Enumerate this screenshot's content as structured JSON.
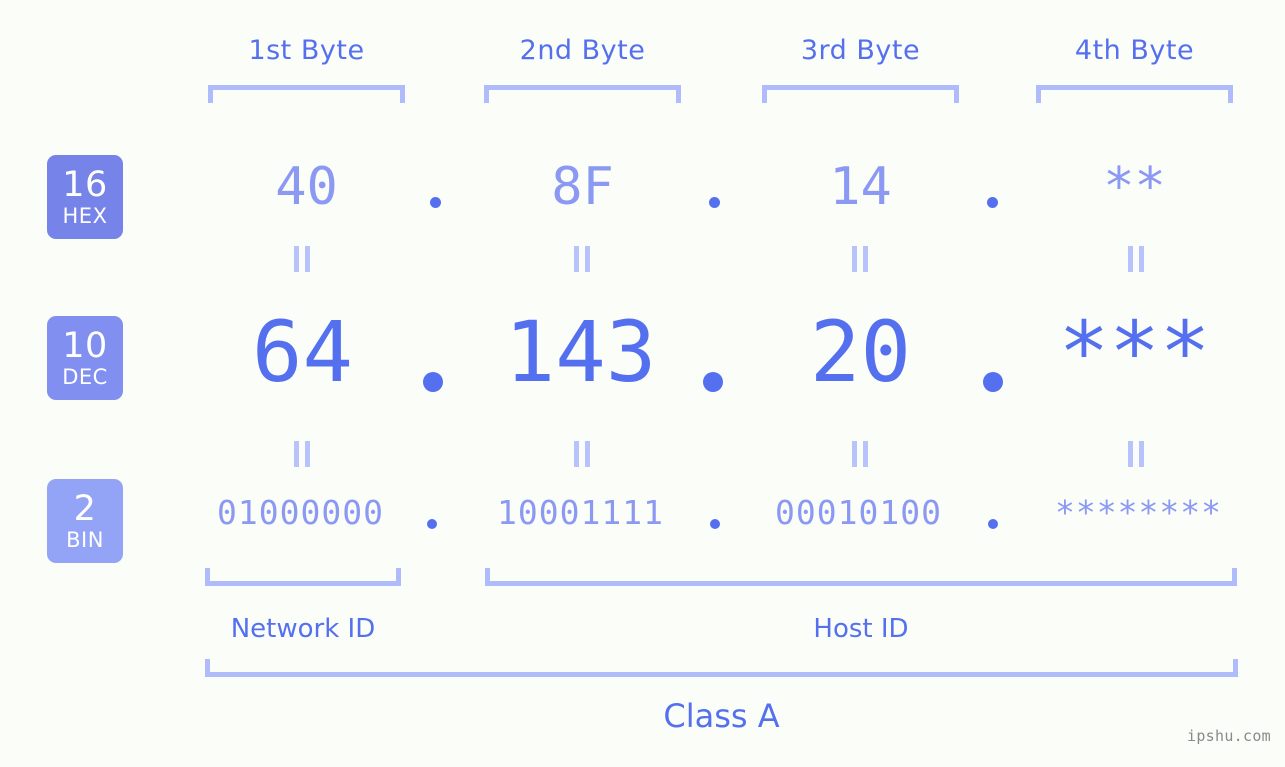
{
  "theme": {
    "background": "#fbfdf9",
    "accent_strong": "#5570ee",
    "accent_light": "#8b99f3",
    "bracket": "#b0bbfb",
    "equals": "#b9c3fb",
    "badge_hex_bg": "#7683e8",
    "badge_dec_bg": "#8190f0",
    "badge_bin_bg": "#93a3f5",
    "watermark_color": "#8a8a8a"
  },
  "byte_headers": [
    {
      "label": "1st Byte"
    },
    {
      "label": "2nd Byte"
    },
    {
      "label": "3rd Byte"
    },
    {
      "label": "4th Byte"
    }
  ],
  "radix_badges": [
    {
      "base": "16",
      "name": "HEX"
    },
    {
      "base": "10",
      "name": "DEC"
    },
    {
      "base": "2",
      "name": "BIN"
    }
  ],
  "rows": {
    "hex": {
      "base": "16",
      "name": "HEX",
      "values": [
        "40",
        "8F",
        "14",
        "**"
      ],
      "separator": "."
    },
    "dec": {
      "base": "10",
      "name": "DEC",
      "values": [
        "64",
        "143",
        "20",
        "***"
      ],
      "separator": "."
    },
    "bin": {
      "base": "2",
      "name": "BIN",
      "values": [
        "01000000",
        "10001111",
        "00010100",
        "********"
      ],
      "separator": "."
    }
  },
  "equality_markers": {
    "glyph": "=",
    "rotated": "true",
    "count_top": 4,
    "count_bottom": 4
  },
  "sections": [
    {
      "label": "Network ID"
    },
    {
      "label": "Host ID"
    }
  ],
  "class_label": "Class A",
  "watermark": "ipshu.com"
}
